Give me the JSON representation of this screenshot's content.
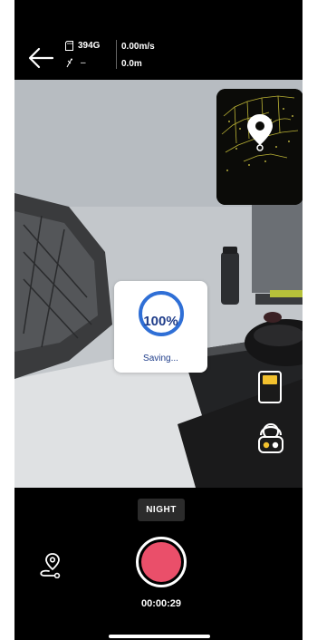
{
  "header": {
    "storage": "394G",
    "gps": "–",
    "speed": "0.00m/s",
    "distance": "0.0m"
  },
  "saving": {
    "progress_percent": 100,
    "percent_label": "100%",
    "status": "Saving..."
  },
  "controls": {
    "mode_label": "NIGHT",
    "timer": "00:00:29"
  },
  "colors": {
    "record": "#ea4f6a",
    "accent_yellow": "#f2c12e",
    "progress_blue": "#2f6fd6"
  },
  "icons": {
    "back": "arrow-left-icon",
    "storage": "sd-card-icon",
    "gps": "satellite-icon",
    "battery": "battery-icon",
    "robot": "robot-icon",
    "route": "route-icon",
    "location": "location-pin-icon"
  }
}
